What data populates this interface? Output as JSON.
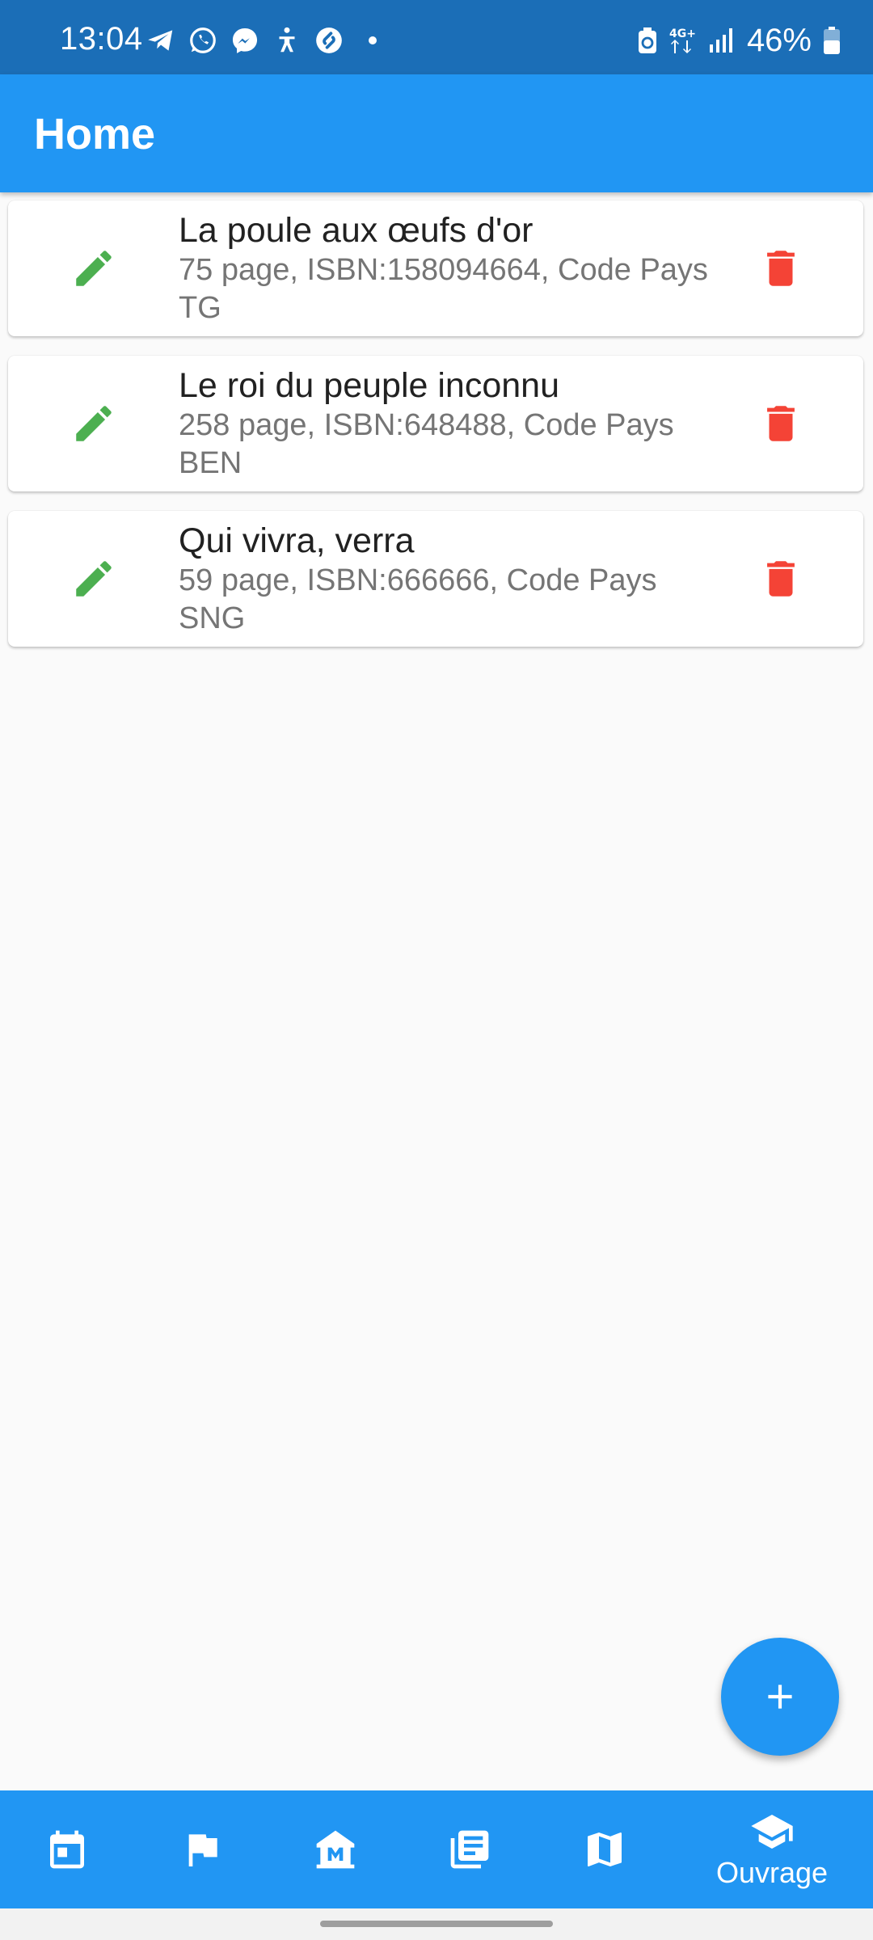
{
  "status_bar": {
    "time": "13:04",
    "battery_percent": "46%",
    "network": "4G+",
    "app_icons": [
      "telegram-icon",
      "whatsapp-icon",
      "messenger-icon",
      "accessibility-icon",
      "shazam-icon"
    ]
  },
  "app_bar": {
    "title": "Home"
  },
  "books": [
    {
      "title": "La poule aux œufs d'or",
      "subtitle": "75 page, ISBN:158094664, Code Pays TG"
    },
    {
      "title": "Le roi du peuple inconnu",
      "subtitle": "258 page, ISBN:648488, Code Pays BEN"
    },
    {
      "title": "Qui vivra, verra",
      "subtitle": "59 page, ISBN:666666, Code Pays SNG"
    }
  ],
  "fab": {
    "icon": "plus-icon"
  },
  "bottom_nav": {
    "items": [
      {
        "icon": "calendar-icon",
        "label": ""
      },
      {
        "icon": "flag-icon",
        "label": ""
      },
      {
        "icon": "museum-icon",
        "label": ""
      },
      {
        "icon": "library-books-icon",
        "label": ""
      },
      {
        "icon": "map-icon",
        "label": ""
      },
      {
        "icon": "school-icon",
        "label": "Ouvrage"
      }
    ],
    "active_index": 5
  },
  "colors": {
    "status_bar": "#1b6eb7",
    "primary": "#2196f3",
    "edit": "#4caf50",
    "delete": "#f44336",
    "background": "#fafafa"
  }
}
